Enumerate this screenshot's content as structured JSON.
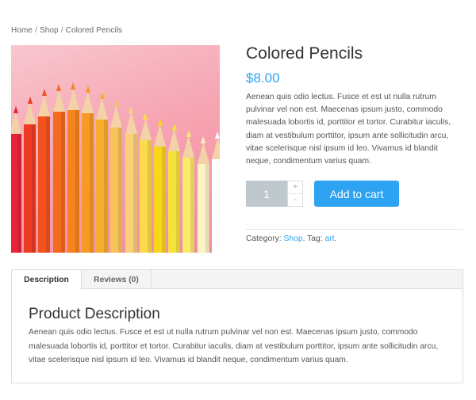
{
  "breadcrumb": {
    "home": "Home",
    "sep1": "/",
    "shop": "Shop",
    "sep2": "/",
    "current": "Colored Pencils"
  },
  "product": {
    "title": "Colored Pencils",
    "price": "$8.00",
    "short_description": "Aenean quis odio lectus. Fusce et est ut nulla rutrum pulvinar vel non est. Maecenas ipsum justo, commodo malesuada lobortis id, porttitor et tortor. Curabitur iaculis, diam at vestibulum porttitor, ipsum ante sollicitudin arcu, vitae scelerisque nisl ipsum id leo. Vivamus id blandit neque, condimentum varius quam.",
    "image_icon": "colored-pencils-photo",
    "pencil_colors": [
      "#e8233a",
      "#ee3b24",
      "#f2521e",
      "#f46a1f",
      "#f6831f",
      "#f69a24",
      "#f7ae2f",
      "#f9c25a",
      "#fbd07a",
      "#fbdb4a",
      "#f8d71b",
      "#f6e23c",
      "#fbea6a",
      "#fdf2c4",
      "#ffffff"
    ]
  },
  "purchase": {
    "quantity": "1",
    "plus_symbol": "+",
    "minus_symbol": "-",
    "add_to_cart_label": "Add to cart"
  },
  "meta": {
    "category_label": "Category:",
    "category_value": "Shop",
    "tag_label": "Tag:",
    "tag_value": "art"
  },
  "tabs": [
    {
      "label": "Description"
    },
    {
      "label": "Reviews (0)"
    }
  ],
  "description_panel": {
    "title": "Product Description",
    "text": "Aenean quis odio lectus. Fusce et est ut nulla rutrum pulvinar vel non est. Maecenas ipsum justo, commodo malesuada lobortis id, porttitor et tortor. Curabitur iaculis, diam at vestibulum porttitor, ipsum ante sollicitudin arcu, vitae scelerisque nisl ipsum id leo. Vivamus id blandit neque, condimentum varius quam."
  },
  "colors": {
    "accent": "#2ea3f2",
    "qty_bg": "#bfc8cc"
  }
}
